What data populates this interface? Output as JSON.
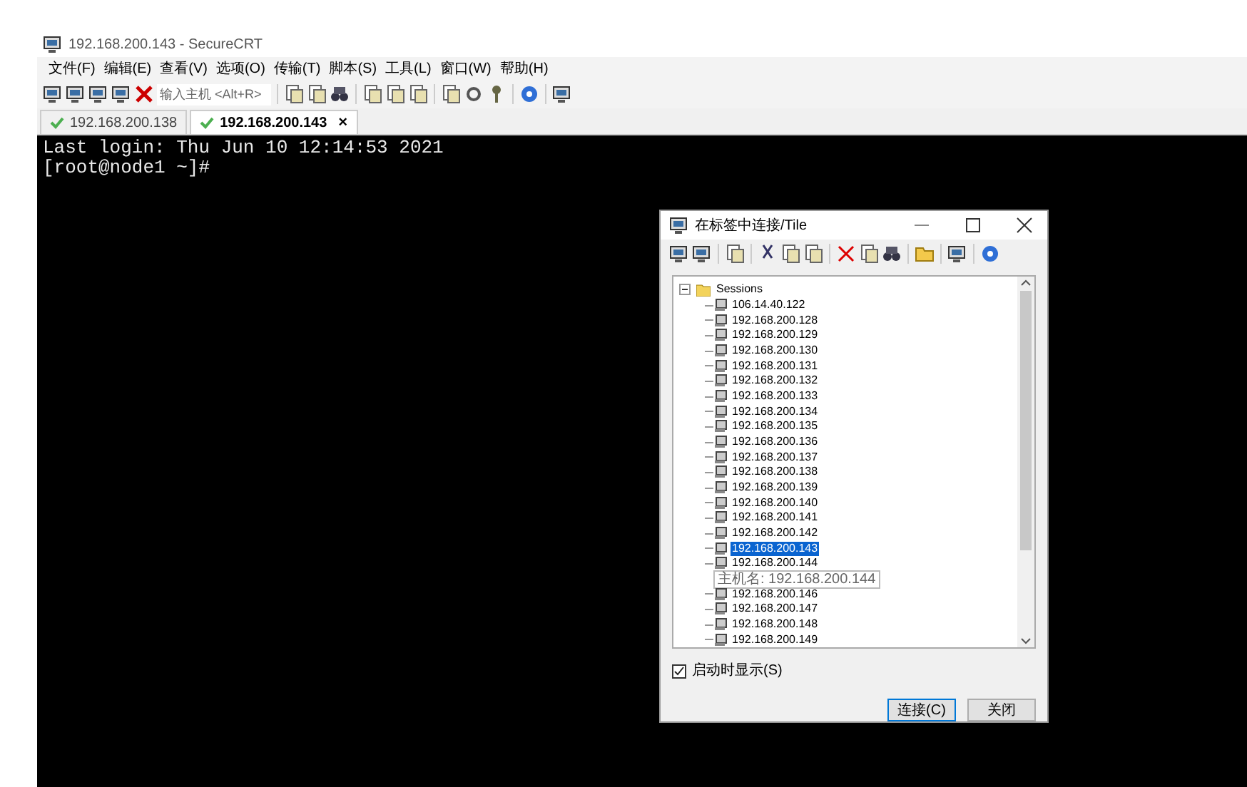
{
  "window": {
    "title": "192.168.200.143 - SecureCRT"
  },
  "menu": [
    "文件(F)",
    "编辑(E)",
    "查看(V)",
    "选项(O)",
    "传输(T)",
    "脚本(S)",
    "工具(L)",
    "窗口(W)",
    "帮助(H)"
  ],
  "toolbar": {
    "host_field": {
      "placeholder": "输入主机 <Alt+R>"
    }
  },
  "tabs": [
    {
      "label": "192.168.200.138",
      "selected": false
    },
    {
      "label": "192.168.200.143",
      "selected": true,
      "close": "×"
    }
  ],
  "terminal": {
    "lines": [
      "Last login: Thu Jun 10 12:14:53 2021",
      "[root@node1 ~]#"
    ]
  },
  "dialog": {
    "title": "在标签中连接/Tile",
    "tree": {
      "label": "Sessions",
      "expanded": true,
      "children": [
        {
          "kind": "session",
          "label": "106.14.40.122",
          "selected": false
        },
        {
          "kind": "session",
          "label": "192.168.200.128",
          "selected": false
        },
        {
          "kind": "session",
          "label": "192.168.200.129",
          "selected": false
        },
        {
          "kind": "session",
          "label": "192.168.200.130",
          "selected": false
        },
        {
          "kind": "session",
          "label": "192.168.200.131",
          "selected": false
        },
        {
          "kind": "session",
          "label": "192.168.200.132",
          "selected": false
        },
        {
          "kind": "session",
          "label": "192.168.200.133",
          "selected": false
        },
        {
          "kind": "session",
          "label": "192.168.200.134",
          "selected": false
        },
        {
          "kind": "session",
          "label": "192.168.200.135",
          "selected": false
        },
        {
          "kind": "session",
          "label": "192.168.200.136",
          "selected": false
        },
        {
          "kind": "session",
          "label": "192.168.200.137",
          "selected": false
        },
        {
          "kind": "session",
          "label": "192.168.200.138",
          "selected": false
        },
        {
          "kind": "session",
          "label": "192.168.200.139",
          "selected": false
        },
        {
          "kind": "session",
          "label": "192.168.200.140",
          "selected": false
        },
        {
          "kind": "session",
          "label": "192.168.200.141",
          "selected": false
        },
        {
          "kind": "session",
          "label": "192.168.200.142",
          "selected": false
        },
        {
          "kind": "session",
          "label": "192.168.200.143",
          "selected": true
        },
        {
          "kind": "session",
          "label": "192.168.200.144",
          "selected": false
        },
        {
          "kind": "tooltip",
          "label": "主机名: 192.168.200.144"
        },
        {
          "kind": "session",
          "label": "192.168.200.146",
          "selected": false
        },
        {
          "kind": "session",
          "label": "192.168.200.147",
          "selected": false
        },
        {
          "kind": "session",
          "label": "192.168.200.148",
          "selected": false
        },
        {
          "kind": "session",
          "label": "192.168.200.149",
          "selected": false
        }
      ]
    },
    "show_on_startup": {
      "label": "启动时显示(S)",
      "checked": true
    },
    "buttons": [
      "连接(C)",
      "关闭"
    ]
  }
}
